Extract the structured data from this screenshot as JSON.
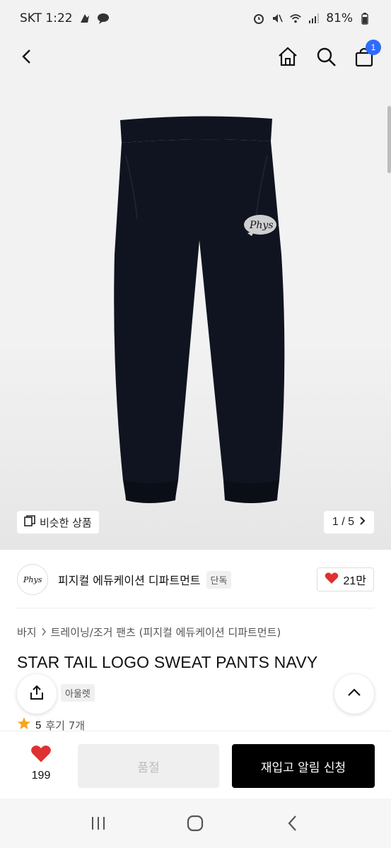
{
  "status_bar": {
    "carrier_time": "SKT 1:22",
    "battery": "81%"
  },
  "header": {
    "icons": [
      "back-arrow-icon",
      "home-icon",
      "search-icon",
      "shopping-bag-icon"
    ],
    "cart_count": "1"
  },
  "hero": {
    "similar_label": "비슷한 상품",
    "pager": "1 / 5",
    "logo_text": "Phys"
  },
  "brand": {
    "name": "피지컬 에듀케이션 디파트먼트",
    "badge": "단독",
    "likes": "21만"
  },
  "product": {
    "breadcrumb": [
      "바지",
      "트레이닝/조거 팬츠 (피지컬 에듀케이션 디파트먼트)"
    ],
    "title": "STAR TAIL LOGO SWEAT PANTS NAVY",
    "outlet_badge": "아울렛",
    "rating": "5",
    "reviews": "후기 7개"
  },
  "actions": {
    "wish_count": "199",
    "soldout_label": "품절",
    "restock_label": "재입고 알림 신청"
  },
  "colors": {
    "accent_blue": "#2f6bff",
    "heart_red": "#e03131",
    "star": "#f5a623",
    "pants_navy": "#0f1420"
  }
}
